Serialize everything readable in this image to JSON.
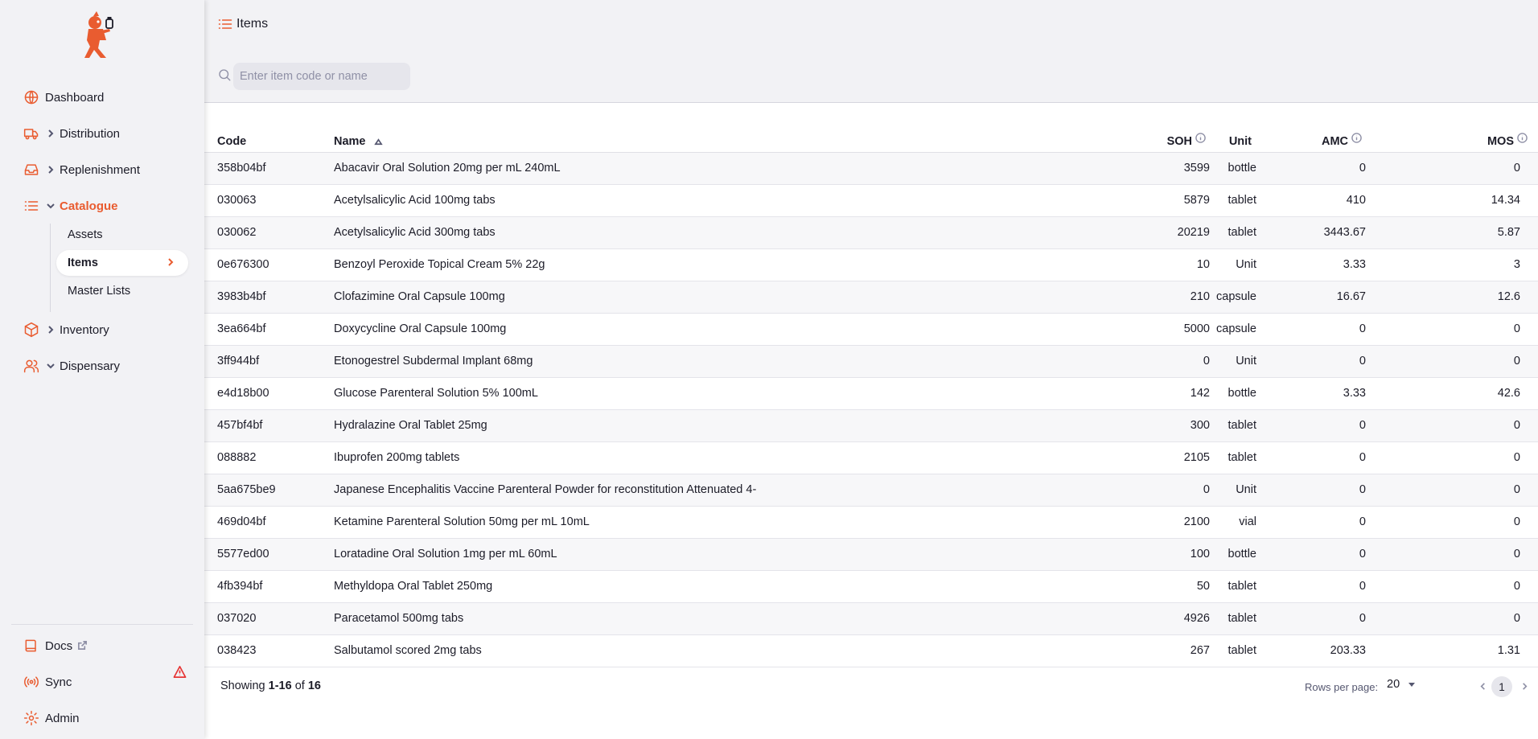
{
  "brand": {
    "accent": "#e95c30",
    "sidebar_bg": "#f2f2f5",
    "warning": "#e63535"
  },
  "sidebar": {
    "items": [
      {
        "label": "Dashboard",
        "icon": "globe-icon"
      },
      {
        "label": "Distribution",
        "icon": "truck-icon",
        "expandable": true
      },
      {
        "label": "Replenishment",
        "icon": "inbox-icon",
        "expandable": true
      },
      {
        "label": "Catalogue",
        "icon": "list-icon",
        "expandable": true,
        "expanded": true,
        "active": true
      },
      {
        "label": "Inventory",
        "icon": "box-icon",
        "expandable": true
      },
      {
        "label": "Dispensary",
        "icon": "users-icon",
        "expandable": true,
        "expanded": true
      }
    ],
    "catalogue_sub": [
      {
        "label": "Assets"
      },
      {
        "label": "Items",
        "active": true
      },
      {
        "label": "Master Lists"
      }
    ],
    "bottom": [
      {
        "label": "Docs",
        "icon": "book-icon"
      },
      {
        "label": "Sync",
        "icon": "radio-icon",
        "warning": true
      },
      {
        "label": "Admin",
        "icon": "gear-icon"
      }
    ]
  },
  "page": {
    "title": "Items",
    "search_placeholder": "Enter item code or name"
  },
  "table": {
    "columns": {
      "code": "Code",
      "name": "Name",
      "unit": "Unit",
      "soh": "SOH",
      "amc": "AMC",
      "mos": "MOS"
    },
    "sorted_by": "Name",
    "rows": [
      {
        "code": "358b04bf",
        "name": "Abacavir Oral Solution 20mg per mL 240mL",
        "unit": "bottle",
        "soh": "3599",
        "amc": "0",
        "mos": "0"
      },
      {
        "code": "030063",
        "name": "Acetylsalicylic Acid 100mg tabs",
        "unit": "tablet",
        "soh": "5879",
        "amc": "410",
        "mos": "14.34"
      },
      {
        "code": "030062",
        "name": "Acetylsalicylic Acid 300mg tabs",
        "unit": "tablet",
        "soh": "20219",
        "amc": "3443.67",
        "mos": "5.87"
      },
      {
        "code": "0e676300",
        "name": "Benzoyl Peroxide Topical Cream 5% 22g",
        "unit": "Unit",
        "soh": "10",
        "amc": "3.33",
        "mos": "3"
      },
      {
        "code": "3983b4bf",
        "name": "Clofazimine Oral Capsule 100mg",
        "unit": "capsule",
        "soh": "210",
        "amc": "16.67",
        "mos": "12.6"
      },
      {
        "code": "3ea664bf",
        "name": "Doxycycline Oral Capsule 100mg",
        "unit": "capsule",
        "soh": "5000",
        "amc": "0",
        "mos": "0"
      },
      {
        "code": "3ff944bf",
        "name": "Etonogestrel Subdermal Implant 68mg",
        "unit": "Unit",
        "soh": "0",
        "amc": "0",
        "mos": "0"
      },
      {
        "code": "e4d18b00",
        "name": "Glucose Parenteral Solution 5% 100mL",
        "unit": "bottle",
        "soh": "142",
        "amc": "3.33",
        "mos": "42.6"
      },
      {
        "code": "457bf4bf",
        "name": "Hydralazine Oral Tablet 25mg",
        "unit": "tablet",
        "soh": "300",
        "amc": "0",
        "mos": "0"
      },
      {
        "code": "088882",
        "name": "Ibuprofen 200mg tablets",
        "unit": "tablet",
        "soh": "2105",
        "amc": "0",
        "mos": "0"
      },
      {
        "code": "5aa675be9",
        "name": "Japanese Encephalitis Vaccine Parenteral Powder for reconstitution Attenuated 4-",
        "unit": "Unit",
        "soh": "0",
        "amc": "0",
        "mos": "0"
      },
      {
        "code": "469d04bf",
        "name": "Ketamine Parenteral Solution 50mg per mL 10mL",
        "unit": "vial",
        "soh": "2100",
        "amc": "0",
        "mos": "0"
      },
      {
        "code": "5577ed00",
        "name": "Loratadine Oral Solution 1mg per mL 60mL",
        "unit": "bottle",
        "soh": "100",
        "amc": "0",
        "mos": "0"
      },
      {
        "code": "4fb394bf",
        "name": "Methyldopa Oral Tablet 250mg",
        "unit": "tablet",
        "soh": "50",
        "amc": "0",
        "mos": "0"
      },
      {
        "code": "037020",
        "name": "Paracetamol 500mg tabs",
        "unit": "tablet",
        "soh": "4926",
        "amc": "0",
        "mos": "0"
      },
      {
        "code": "038423",
        "name": "Salbutamol scored 2mg tabs",
        "unit": "tablet",
        "soh": "267",
        "amc": "203.33",
        "mos": "1.31"
      }
    ]
  },
  "footer": {
    "showing_prefix": "Showing ",
    "range": "1-16",
    "of": " of ",
    "total": "16",
    "rows_per_page_label": "Rows per page:",
    "rows_per_page": "20",
    "current_page": "1"
  }
}
